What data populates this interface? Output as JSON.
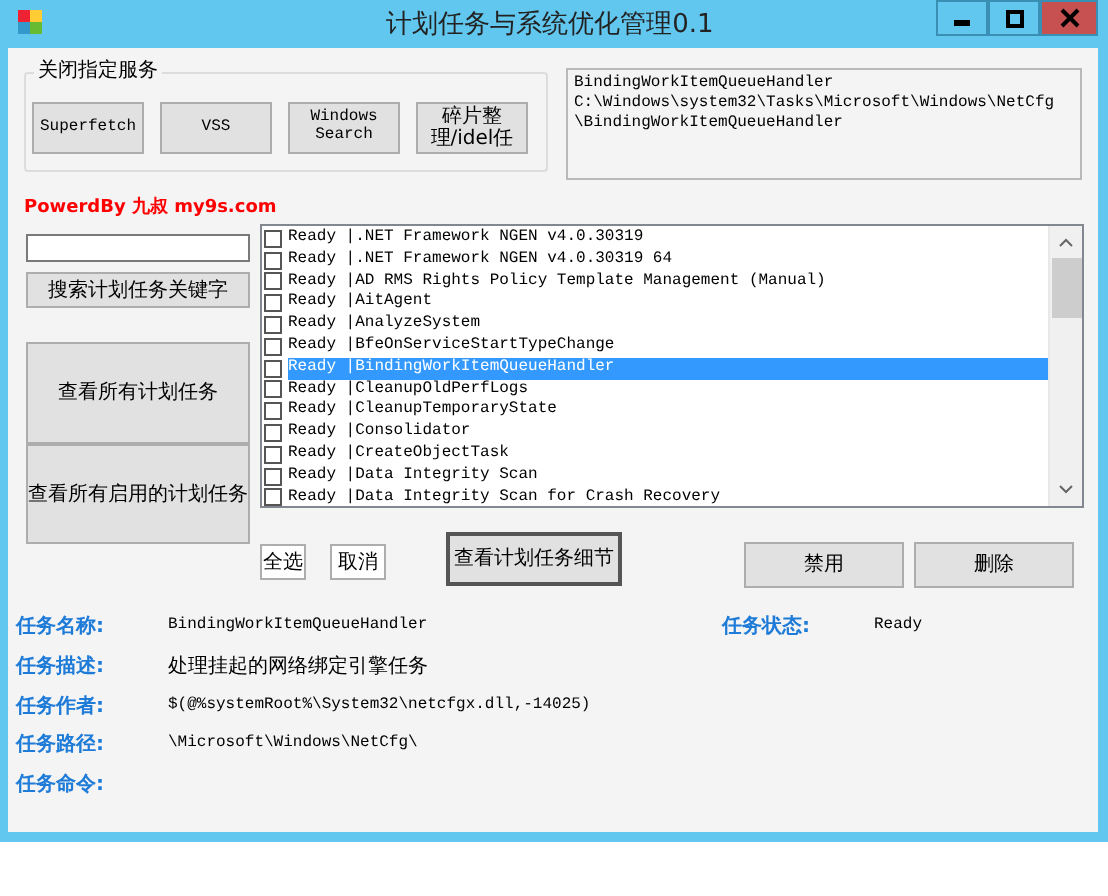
{
  "window": {
    "title": "计划任务与系统优化管理0.1"
  },
  "services": {
    "legend": "关闭指定服务",
    "buttons": [
      "Superfetch",
      "VSS",
      "Windows Search",
      "碎片整理/idel任"
    ]
  },
  "path_box": {
    "lines": [
      "BindingWorkItemQueueHandler",
      "C:\\Windows\\system32\\Tasks\\Microsoft\\Windows\\NetCfg",
      "\\BindingWorkItemQueueHandler"
    ]
  },
  "credit": "PowerdBy 九叔 my9s.com",
  "search": {
    "button": "搜索计划任务关键字"
  },
  "view_all_button": "查看所有计划任务",
  "view_enabled_button": "查看所有启用的计划任务",
  "task_list": [
    {
      "text": "Ready |.NET Framework NGEN v4.0.30319",
      "checked": false,
      "selected": false
    },
    {
      "text": "Ready |.NET Framework NGEN v4.0.30319 64",
      "checked": false,
      "selected": false
    },
    {
      "text": "Ready |AD RMS Rights Policy Template Management (Manual)",
      "checked": false,
      "selected": false
    },
    {
      "text": "Ready |AitAgent",
      "checked": false,
      "selected": false
    },
    {
      "text": "Ready |AnalyzeSystem",
      "checked": false,
      "selected": false
    },
    {
      "text": "Ready |BfeOnServiceStartTypeChange",
      "checked": false,
      "selected": false
    },
    {
      "text": "Ready |BindingWorkItemQueueHandler",
      "checked": false,
      "selected": true
    },
    {
      "text": "Ready |CleanupOldPerfLogs",
      "checked": false,
      "selected": false
    },
    {
      "text": "Ready |CleanupTemporaryState",
      "checked": false,
      "selected": false
    },
    {
      "text": "Ready |Consolidator",
      "checked": false,
      "selected": false
    },
    {
      "text": "Ready |CreateObjectTask",
      "checked": false,
      "selected": false
    },
    {
      "text": "Ready |Data Integrity Scan",
      "checked": false,
      "selected": false
    },
    {
      "text": "Ready |Data Integrity Scan for Crash Recovery",
      "checked": false,
      "selected": false
    }
  ],
  "list_buttons": {
    "select_all": "全选",
    "cancel": "取消",
    "details": "查看计划任务细节",
    "disable": "禁用",
    "delete": "删除"
  },
  "details": {
    "name_label": "任务名称:",
    "name": "BindingWorkItemQueueHandler",
    "status_label": "任务状态:",
    "status": "Ready",
    "description_label": "任务描述:",
    "description": "处理挂起的网络绑定引擎任务",
    "author_label": "任务作者:",
    "author": "$(@%systemRoot%\\System32\\netcfgx.dll,-14025)",
    "path_label": "任务路径:",
    "path": "\\Microsoft\\Windows\\NetCfg\\",
    "command_label": "任务命令:"
  }
}
